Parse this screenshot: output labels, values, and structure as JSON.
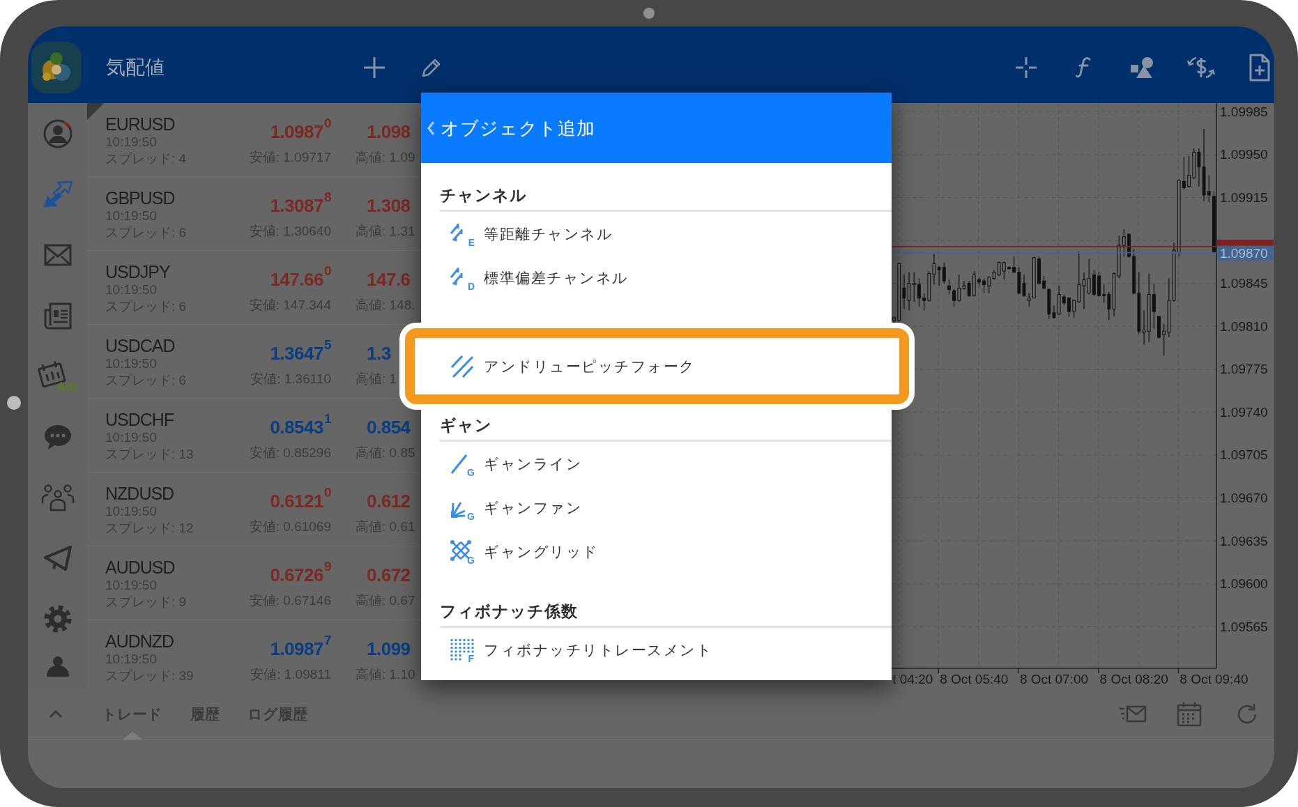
{
  "top_bar": {
    "title": "気配値"
  },
  "sidebar": {
    "items": [
      {
        "kind": "person",
        "selected": false
      },
      {
        "kind": "arrows",
        "selected": true
      },
      {
        "kind": "envelope",
        "selected": false
      },
      {
        "kind": "newspaper",
        "selected": false
      },
      {
        "kind": "calendar",
        "selected": false,
        "label": "Ads"
      },
      {
        "kind": "chat",
        "selected": false
      },
      {
        "kind": "people",
        "selected": false
      },
      {
        "kind": "plane",
        "selected": false
      },
      {
        "kind": "gear",
        "selected": false
      },
      {
        "kind": "figure",
        "selected": false
      }
    ]
  },
  "quotes": [
    {
      "symbol": "EURUSD",
      "time": "10:19:50",
      "spread": "スプレッド: 4",
      "color": "#7a2a22",
      "bid": "1.09**87**$^{0}$",
      "low": "安値: 1.09717",
      "ask": "1.09**8**",
      "high": "高値: 1.09"
    },
    {
      "symbol": "GBPUSD",
      "time": "10:19:50",
      "spread": "スプレッド: 6",
      "color": "#7a2a22",
      "bid": "1.30**87**$^{8}$",
      "low": "安値: 1.30640",
      "ask": "1.30**8**",
      "high": "高値: 1.31"
    },
    {
      "symbol": "USDJPY",
      "time": "10:19:50",
      "spread": "スプレッド: 6",
      "color": "#7a2a22",
      "bid": "147.**66**$^{0}$",
      "low": "安値: 147.344",
      "ask": "147.**6**",
      "high": "高値: 148."
    },
    {
      "symbol": "USDCAD",
      "time": "10:19:50",
      "spread": "スプレッド: 6",
      "color": "#0b3d80",
      "bid": "1.36**47**$^{5}$",
      "low": "安値: 1.36110",
      "ask": "1.3",
      "high": "高値: 1"
    },
    {
      "symbol": "USDCHF",
      "time": "10:19:50",
      "spread": "スプレッド: 13",
      "color": "#0b3d80",
      "bid": "0.85**43**$^{1}$",
      "low": "安値: 0.85296",
      "ask": "0.85**4**",
      "high": "高値: 0.85"
    },
    {
      "symbol": "NZDUSD",
      "time": "10:19:50",
      "spread": "スプレッド: 12",
      "color": "#7a2a22",
      "bid": "0.61**21**$^{0}$",
      "low": "安値: 0.61069",
      "ask": "0.61**2**",
      "high": "高値: 0.61"
    },
    {
      "symbol": "AUDUSD",
      "time": "10:19:50",
      "spread": "スプレッド: 9",
      "color": "#7a2a22",
      "bid": "0.67**26**$^{9}$",
      "low": "安値: 0.67146",
      "ask": "0.67**2**",
      "high": "高値: 0.67"
    },
    {
      "symbol": "AUDNZD",
      "time": "10:19:50",
      "spread": "スプレッド: 39",
      "color": "#0b3d80",
      "bid": "1.09**87**$^{7}$",
      "low": "安値: 1.09811",
      "ask": "1.09**9**",
      "high": "高値: 1.10"
    }
  ],
  "chart": {
    "partial_time_label": "t 04:20",
    "chart_data": {
      "type": "candlestick",
      "grid": true,
      "ylim": [
        1.09531,
        1.09992
      ],
      "yticks": [
        {
          "value": 1.09985,
          "label": "1.09985"
        },
        {
          "value": 1.0995,
          "label": "1.09950"
        },
        {
          "value": 1.09915,
          "label": "1.09915"
        },
        {
          "value": 1.09845,
          "label": "1.09845"
        },
        {
          "value": 1.0981,
          "label": "1.09810"
        },
        {
          "value": 1.09775,
          "label": "1.09775"
        },
        {
          "value": 1.0974,
          "label": "1.09740"
        },
        {
          "value": 1.09705,
          "label": "1.09705"
        },
        {
          "value": 1.0967,
          "label": "1.09670"
        },
        {
          "value": 1.09635,
          "label": "1.09635"
        },
        {
          "value": 1.096,
          "label": "1.09600"
        },
        {
          "value": 1.09565,
          "label": "1.09565"
        }
      ],
      "ref_lines": [
        {
          "axis": "y",
          "value": 1.09875,
          "color": "#7d2020"
        },
        {
          "axis": "y",
          "value": 1.0987,
          "color": "#41658f",
          "label": "1.09870"
        }
      ],
      "categories": [
        null,
        null,
        null,
        null,
        null,
        null,
        null,
        null,
        null,
        null,
        null,
        null,
        null,
        null,
        null,
        null,
        "8 Oct 05:40",
        null,
        null,
        null,
        null,
        null,
        null,
        null,
        null,
        null,
        null,
        null,
        null,
        null,
        null,
        null,
        "8 Oct 07:00",
        null,
        null,
        null,
        null,
        null,
        null,
        null,
        null,
        null,
        null,
        null,
        null,
        null,
        null,
        null,
        "8 Oct 08:20",
        null,
        null,
        null,
        null,
        null,
        null,
        null,
        null,
        null,
        null,
        null,
        null,
        null,
        null,
        null,
        "8 Oct 09:40"
      ],
      "ohlc": [
        [
          1.09815,
          1.09818,
          1.09813,
          1.09817
        ],
        [
          1.09815,
          1.09862,
          1.09814,
          1.09861
        ],
        [
          1.09841,
          1.09852,
          1.09824,
          1.09833
        ],
        [
          1.09831,
          1.09854,
          1.09823,
          1.09845
        ],
        [
          1.09844,
          1.09854,
          1.0983,
          1.09845
        ],
        [
          1.09844,
          1.09849,
          1.09826,
          1.09833
        ],
        [
          1.09833,
          1.09837,
          1.09823,
          1.09831
        ],
        [
          1.09831,
          1.09855,
          1.0983,
          1.09853
        ],
        [
          1.09852,
          1.09869,
          1.09844,
          1.09861
        ],
        [
          1.09858,
          1.09859,
          1.09843,
          1.09856
        ],
        [
          1.09858,
          1.09862,
          1.09845,
          1.09847
        ],
        [
          1.09843,
          1.09848,
          1.09836,
          1.0984
        ],
        [
          1.09839,
          1.09841,
          1.09826,
          1.09831
        ],
        [
          1.09831,
          1.09852,
          1.0983,
          1.09841
        ],
        [
          1.09841,
          1.09847,
          1.0984,
          1.09843
        ],
        [
          1.09845,
          1.09847,
          1.09834,
          1.09835
        ],
        [
          1.09835,
          1.09855,
          1.09834,
          1.09852
        ],
        [
          1.09848,
          1.0985,
          1.09843,
          1.09846
        ],
        [
          1.09847,
          1.09849,
          1.09837,
          1.09844
        ],
        [
          1.09843,
          1.09851,
          1.09837,
          1.0985
        ],
        [
          1.09849,
          1.09856,
          1.09848,
          1.09854
        ],
        [
          1.09852,
          1.09863,
          1.09851,
          1.09862
        ],
        [
          1.09855,
          1.09863,
          1.09848,
          1.09862
        ],
        [
          1.09858,
          1.09859,
          1.09856,
          1.09857
        ],
        [
          1.09858,
          1.09867,
          1.09854,
          1.09854
        ],
        [
          1.09854,
          1.09858,
          1.09836,
          1.09837
        ],
        [
          1.09845,
          1.09852,
          1.09834,
          1.09835
        ],
        [
          1.09831,
          1.09837,
          1.09826,
          1.09833
        ],
        [
          1.09833,
          1.09867,
          1.09833,
          1.09866
        ],
        [
          1.09865,
          1.09867,
          1.09844,
          1.09845
        ],
        [
          1.09847,
          1.09851,
          1.0984,
          1.09841
        ],
        [
          1.0984,
          1.09841,
          1.09816,
          1.0982
        ],
        [
          1.09821,
          1.09827,
          1.09816,
          1.09817
        ],
        [
          1.0982,
          1.09843,
          1.09819,
          1.09836
        ],
        [
          1.09834,
          1.09836,
          1.09827,
          1.09829
        ],
        [
          1.09833,
          1.09834,
          1.09818,
          1.09822
        ],
        [
          1.09822,
          1.09832,
          1.09817,
          1.09831
        ],
        [
          1.0983,
          1.09871,
          1.09829,
          1.09844
        ],
        [
          1.09843,
          1.09854,
          1.09824,
          1.09848
        ],
        [
          1.09837,
          1.09865,
          1.09836,
          1.09849
        ],
        [
          1.09852,
          1.09856,
          1.09835,
          1.09836
        ],
        [
          1.09851,
          1.09854,
          1.09834,
          1.09835
        ],
        [
          1.09836,
          1.09844,
          1.09829,
          1.09835
        ],
        [
          1.09836,
          1.09838,
          1.09815,
          1.09824
        ],
        [
          1.09824,
          1.09854,
          1.09818,
          1.09853
        ],
        [
          1.09851,
          1.09884,
          1.09849,
          1.09876
        ],
        [
          1.09876,
          1.09889,
          1.09867,
          1.09883
        ],
        [
          1.09885,
          1.09886,
          1.09866,
          1.09867
        ],
        [
          1.09867,
          1.09873,
          1.09836,
          1.09837
        ],
        [
          1.09837,
          1.09854,
          1.09804,
          1.09806
        ],
        [
          1.09805,
          1.09823,
          1.09795,
          1.09807
        ],
        [
          1.09806,
          1.09853,
          1.09797,
          1.09836
        ],
        [
          1.09836,
          1.09845,
          1.09808,
          1.09822
        ],
        [
          1.09818,
          1.09818,
          1.098,
          1.09801
        ],
        [
          1.09803,
          1.09812,
          1.09786,
          1.09806
        ],
        [
          1.09805,
          1.09849,
          1.09801,
          1.09831
        ],
        [
          1.09831,
          1.09878,
          1.0983,
          1.09872
        ],
        [
          1.0987,
          1.0993,
          1.09867,
          1.09929
        ],
        [
          1.09928,
          1.09948,
          1.09922,
          1.09923
        ],
        [
          1.09924,
          1.09949,
          1.09923,
          1.09933
        ],
        [
          1.09931,
          1.09955,
          1.0993,
          1.09952
        ],
        [
          1.09952,
          1.09955,
          1.09924,
          1.0994
        ],
        [
          1.0994,
          1.09971,
          1.09912,
          1.09917
        ],
        [
          1.0992,
          1.09933,
          1.09911,
          1.09917
        ],
        [
          1.09916,
          1.0992,
          1.0987,
          1.0987
        ]
      ]
    }
  },
  "bottom_bar": {
    "tabs": [
      {
        "label": "トレード",
        "selected": true
      },
      {
        "label": "履歴",
        "selected": false
      },
      {
        "label": "ログ履歴",
        "selected": false
      }
    ]
  },
  "dialog": {
    "title": "オブジェクト追加",
    "sections": [
      {
        "title": "チャンネル",
        "items": [
          {
            "label": "等距離チャンネル",
            "kind": "channel",
            "icon_letter": "E",
            "highlighted": false
          },
          {
            "label": "標準偏差チャンネル",
            "kind": "channel",
            "icon_letter": "D",
            "highlighted": false
          },
          {
            "label": "アンドリューピッチフォーク",
            "kind": "pitchfork",
            "highlighted": true
          }
        ]
      },
      {
        "title": "ギャン",
        "items": [
          {
            "label": "ギャンライン",
            "kind": "line",
            "icon_letter": "G",
            "highlighted": false
          },
          {
            "label": "ギャンファン",
            "kind": "fan",
            "icon_letter": "G",
            "highlighted": false
          },
          {
            "label": "ギャングリッド",
            "kind": "grid",
            "icon_letter": "G",
            "highlighted": false
          }
        ]
      },
      {
        "title": "フィボナッチ係数",
        "items": [
          {
            "label": "フィボナッチリトレースメント",
            "kind": "fibo",
            "icon_letter": "F",
            "highlighted": false
          }
        ]
      }
    ]
  }
}
